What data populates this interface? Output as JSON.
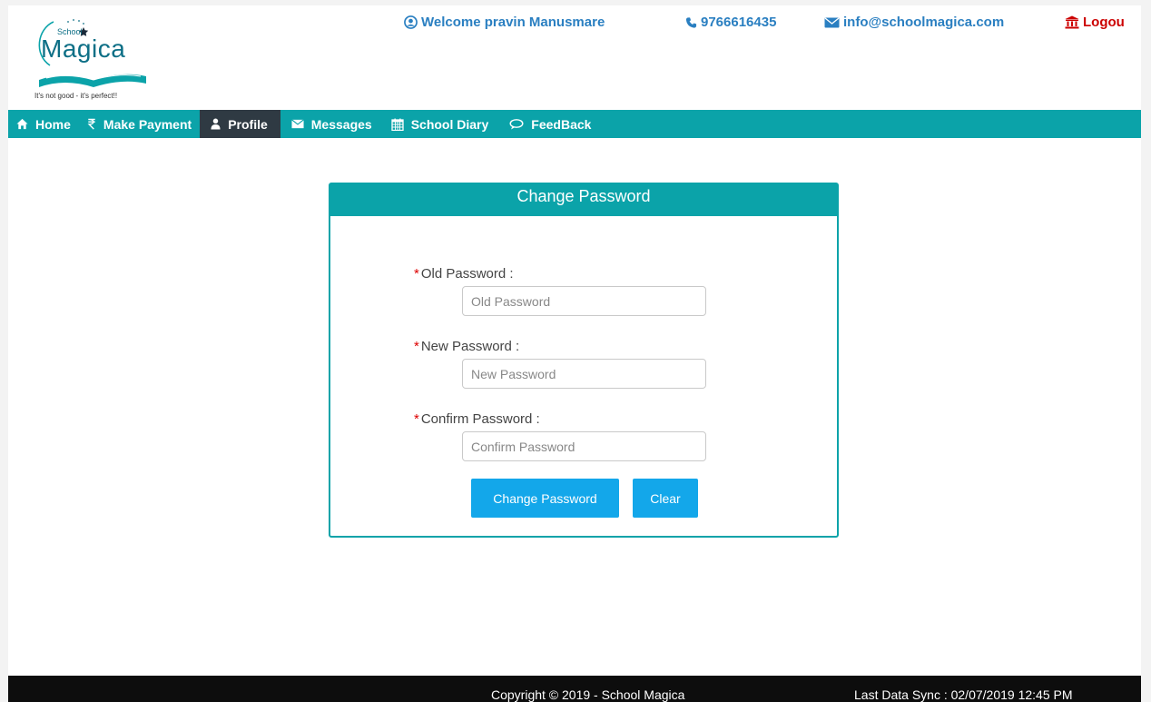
{
  "header": {
    "logo": {
      "small_text": "School",
      "brand": "Magica",
      "tagline": "It's not good - it's perfect!!"
    },
    "welcome": "Welcome pravin Manusmare",
    "phone": "9766616435",
    "email": "info@schoolmagica.com",
    "logout": "Logou",
    "icons": {
      "welcome": "user-circle-icon",
      "phone": "phone-icon",
      "email": "envelope-icon",
      "logout": "institution-icon"
    },
    "colors": {
      "contact": "#2a7fc1",
      "logout": "#cc0000"
    }
  },
  "nav": {
    "items": [
      {
        "label": "Home",
        "icon": "home-icon"
      },
      {
        "label": "Make Payment",
        "icon": "rupee-icon"
      },
      {
        "label": "Profile",
        "icon": "user-icon",
        "active": true
      },
      {
        "label": "Messages",
        "icon": "envelope-icon"
      },
      {
        "label": "School Diary",
        "icon": "calendar-icon"
      },
      {
        "label": "FeedBack",
        "icon": "comment-icon"
      }
    ],
    "colors": {
      "bar": "#0ba3a9",
      "active": "#2f3a43"
    }
  },
  "form": {
    "title": "Change Password",
    "required_marker": "*",
    "fields": [
      {
        "label": "Old Password :",
        "placeholder": "Old Password",
        "value": ""
      },
      {
        "label": "New Password :",
        "placeholder": "New Password",
        "value": ""
      },
      {
        "label": "Confirm Password :",
        "placeholder": "Confirm Password",
        "value": ""
      }
    ],
    "submit_label": "Change Password",
    "clear_label": "Clear",
    "colors": {
      "button": "#13a7ea",
      "required": "#dd0000"
    }
  },
  "footer": {
    "copyright": "Copyright © 2019 - School Magica",
    "last_sync": "Last Data Sync : 02/07/2019 12:45 PM"
  }
}
